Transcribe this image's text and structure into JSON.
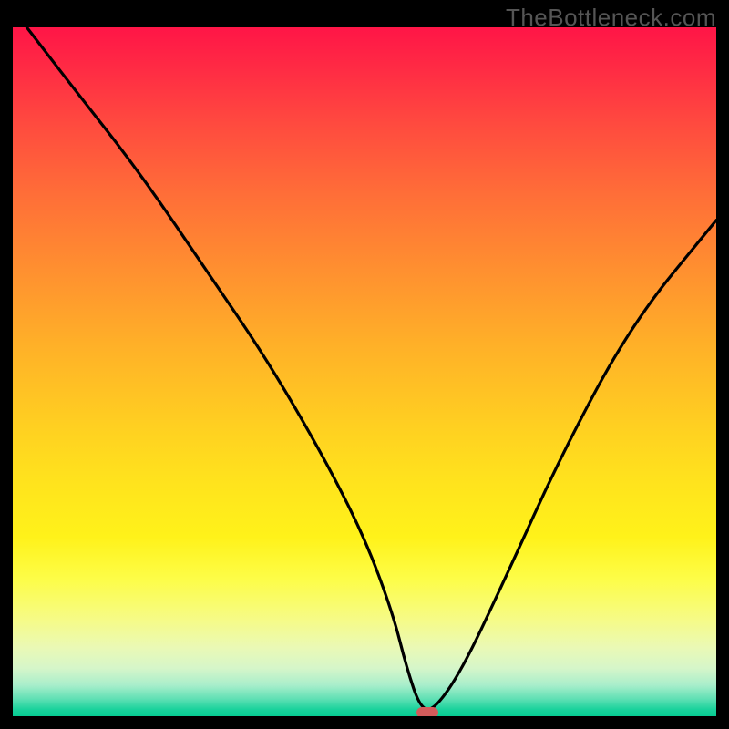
{
  "watermark": "TheBottleneck.com",
  "chart_data": {
    "type": "line",
    "title": "",
    "xlabel": "",
    "ylabel": "",
    "xlim": [
      0,
      100
    ],
    "ylim": [
      0,
      100
    ],
    "x": [
      2,
      8,
      18,
      28,
      36,
      44,
      50,
      54,
      56,
      58,
      60,
      64,
      70,
      78,
      88,
      100
    ],
    "values": [
      100,
      92,
      79,
      64,
      52,
      38,
      26,
      15,
      7,
      1,
      1,
      7,
      20,
      38,
      57,
      72
    ],
    "annotations": [
      {
        "kind": "marker",
        "shape": "pill",
        "color": "#d35b5b",
        "x": 59,
        "y": 0.5
      }
    ],
    "background": {
      "kind": "vertical-gradient",
      "stops": [
        {
          "pos": 0,
          "color": "#ff1547"
        },
        {
          "pos": 24,
          "color": "#ff6d38"
        },
        {
          "pos": 58,
          "color": "#ffd021"
        },
        {
          "pos": 80,
          "color": "#fdfd47"
        },
        {
          "pos": 95.5,
          "color": "#a8eecb"
        },
        {
          "pos": 100,
          "color": "#07cc93"
        }
      ]
    }
  }
}
